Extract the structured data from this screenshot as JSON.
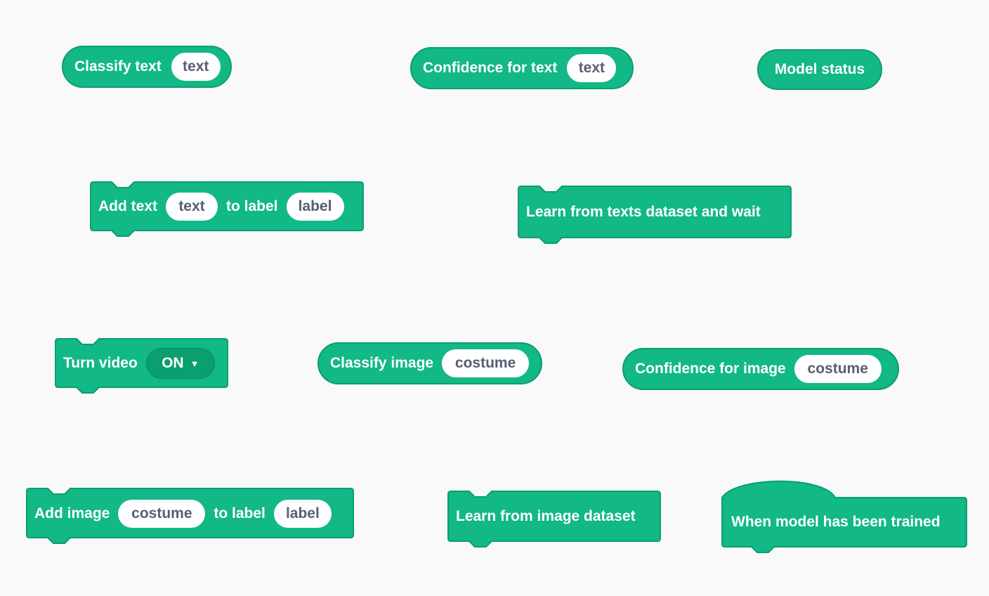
{
  "colors": {
    "block_fill": "#12b886",
    "block_stroke": "#0b9e6f",
    "slot_text": "#575e75",
    "background": "#f9f9f9"
  },
  "blocks": {
    "classify_text": {
      "label": "Classify text",
      "input": "text"
    },
    "confidence_text": {
      "label": "Confidence for text",
      "input": "text"
    },
    "model_status": {
      "label": "Model status"
    },
    "add_text": {
      "label1": "Add text",
      "input1": "text",
      "label2": "to label",
      "input2": "label"
    },
    "learn_texts": {
      "label": "Learn from texts dataset and wait"
    },
    "turn_video": {
      "label": "Turn video",
      "dropdown": "ON"
    },
    "classify_image": {
      "label": "Classify image",
      "input": "costume"
    },
    "confidence_image": {
      "label": "Confidence for image",
      "input": "costume"
    },
    "add_image": {
      "label1": "Add image",
      "input1": "costume",
      "label2": "to label",
      "input2": "label"
    },
    "learn_image": {
      "label": "Learn from image dataset"
    },
    "when_trained": {
      "label": "When model has been trained"
    }
  }
}
